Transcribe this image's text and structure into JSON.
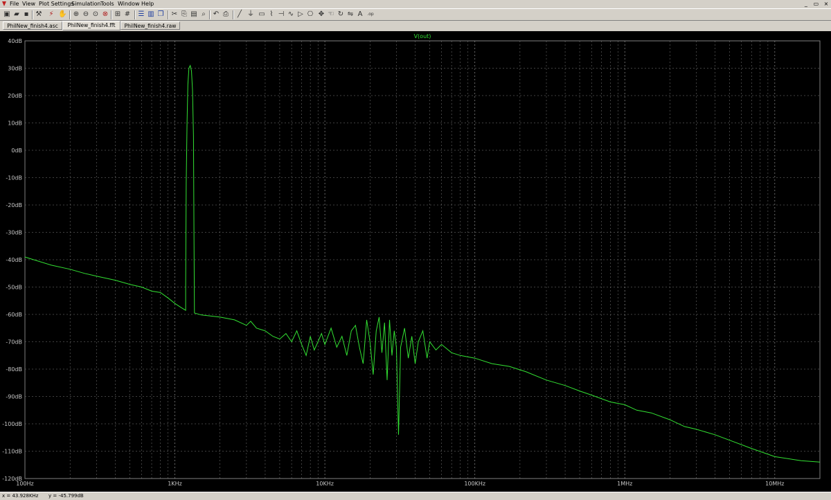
{
  "menu": {
    "items": [
      {
        "label": "File",
        "name": "menu-file"
      },
      {
        "label": "View",
        "name": "menu-view"
      },
      {
        "label": "Plot Settings",
        "name": "menu-plot-settings"
      },
      {
        "label": "Simulation",
        "name": "menu-simulation"
      },
      {
        "label": "Tools",
        "name": "menu-tools"
      },
      {
        "label": "Window",
        "name": "menu-window"
      },
      {
        "label": "Help",
        "name": "menu-help"
      }
    ]
  },
  "window_controls": {
    "minimize": "_",
    "restore": "▭",
    "close": "×"
  },
  "toolbar": {
    "icons": [
      "new-schematic-icon",
      "open-icon",
      "save-icon",
      "control-panel-icon",
      "run-icon",
      "halt-icon",
      "zoom-in-icon",
      "zoom-out-icon",
      "zoom-full-icon",
      "zoom-cancel-icon",
      "autorange-icon",
      "grid-icon",
      "tile-horizontal-icon",
      "tile-vertical-icon",
      "cascade-icon",
      "cut-icon",
      "copy-icon",
      "paste-icon",
      "find-icon",
      "undo-icon",
      "print-icon",
      "wire-icon",
      "ground-icon",
      "label-icon",
      "resistor-icon",
      "capacitor-icon",
      "inductor-icon",
      "diode-icon",
      "component-icon",
      "move-icon",
      "drag-icon",
      "rotate-icon",
      "mirror-icon",
      "text-icon",
      "spice-directive-icon"
    ]
  },
  "tabs": [
    {
      "label": "PhilNew_finish4.asc",
      "name": "tab-schematic",
      "active": false
    },
    {
      "label": "PhilNew_finish4.fft",
      "name": "tab-fft",
      "active": true
    },
    {
      "label": "PhilNew_finish4.raw",
      "name": "tab-raw",
      "active": false
    }
  ],
  "status": {
    "x": "x = 43.928KHz",
    "y": "y = -45.799dB"
  },
  "colors": {
    "trace": "#33e233",
    "grid": "#808080",
    "background": "#000000",
    "axis_text": "#c8c8c8"
  },
  "chart_data": {
    "type": "line",
    "title": "",
    "trace_label": "V(out)",
    "xscale": "log",
    "xlim": [
      100,
      20000000
    ],
    "ylim": [
      -120,
      40
    ],
    "grid": true,
    "x_ticks": [
      {
        "value": 100,
        "label": "100Hz"
      },
      {
        "value": 1000,
        "label": "1KHz"
      },
      {
        "value": 10000,
        "label": "10KHz"
      },
      {
        "value": 100000,
        "label": "100KHz"
      },
      {
        "value": 1000000,
        "label": "1MHz"
      },
      {
        "value": 10000000,
        "label": "10MHz"
      }
    ],
    "y_ticks": [
      {
        "value": 40,
        "label": "40dB"
      },
      {
        "value": 30,
        "label": "30dB"
      },
      {
        "value": 20,
        "label": "20dB"
      },
      {
        "value": 10,
        "label": "10dB"
      },
      {
        "value": 0,
        "label": "0dB"
      },
      {
        "value": -10,
        "label": "-10dB"
      },
      {
        "value": -20,
        "label": "-20dB"
      },
      {
        "value": -30,
        "label": "-30dB"
      },
      {
        "value": -40,
        "label": "-40dB"
      },
      {
        "value": -50,
        "label": "-50dB"
      },
      {
        "value": -60,
        "label": "-60dB"
      },
      {
        "value": -70,
        "label": "-70dB"
      },
      {
        "value": -80,
        "label": "-80dB"
      },
      {
        "value": -90,
        "label": "-90dB"
      },
      {
        "value": -100,
        "label": "-100dB"
      },
      {
        "value": -110,
        "label": "-110dB"
      },
      {
        "value": -120,
        "label": "-120dB"
      }
    ],
    "series": [
      {
        "points": [
          [
            100,
            -39
          ],
          [
            150,
            -42
          ],
          [
            200,
            -43.5
          ],
          [
            250,
            -45
          ],
          [
            300,
            -46
          ],
          [
            400,
            -47.5
          ],
          [
            500,
            -49
          ],
          [
            600,
            -50
          ],
          [
            700,
            -51.5
          ],
          [
            800,
            -52
          ],
          [
            900,
            -54
          ],
          [
            1000,
            -56
          ],
          [
            1100,
            -57.5
          ],
          [
            1180,
            -58.5
          ],
          [
            1180,
            -50
          ],
          [
            1190,
            -12
          ],
          [
            1205,
            10
          ],
          [
            1220,
            24
          ],
          [
            1240,
            30
          ],
          [
            1265,
            31
          ],
          [
            1290,
            29
          ],
          [
            1310,
            22
          ],
          [
            1330,
            5
          ],
          [
            1340,
            -30
          ],
          [
            1350,
            -59.5
          ],
          [
            1500,
            -60.2
          ],
          [
            2000,
            -61
          ],
          [
            2500,
            -62
          ],
          [
            3000,
            -64
          ],
          [
            3200,
            -62.5
          ],
          [
            3500,
            -65
          ],
          [
            4000,
            -66
          ],
          [
            4500,
            -68
          ],
          [
            5000,
            -69
          ],
          [
            5500,
            -67
          ],
          [
            6000,
            -70
          ],
          [
            6500,
            -66
          ],
          [
            7000,
            -71
          ],
          [
            7500,
            -75
          ],
          [
            8000,
            -68
          ],
          [
            8500,
            -73
          ],
          [
            9000,
            -70
          ],
          [
            9500,
            -67
          ],
          [
            10000,
            -71
          ],
          [
            11000,
            -65
          ],
          [
            12000,
            -72
          ],
          [
            13000,
            -68
          ],
          [
            14000,
            -75
          ],
          [
            15000,
            -66
          ],
          [
            16000,
            -64
          ],
          [
            17000,
            -72
          ],
          [
            18000,
            -78
          ],
          [
            19000,
            -62
          ],
          [
            20000,
            -70
          ],
          [
            21000,
            -82
          ],
          [
            22000,
            -66
          ],
          [
            23000,
            -61
          ],
          [
            24000,
            -74
          ],
          [
            25000,
            -63
          ],
          [
            26000,
            -84
          ],
          [
            27000,
            -62
          ],
          [
            28000,
            -75
          ],
          [
            29000,
            -66
          ],
          [
            30000,
            -72
          ],
          [
            31000,
            -104
          ],
          [
            32000,
            -72
          ],
          [
            34000,
            -65
          ],
          [
            36000,
            -76
          ],
          [
            38000,
            -68
          ],
          [
            40000,
            -78
          ],
          [
            42000,
            -70
          ],
          [
            45000,
            -66
          ],
          [
            48000,
            -76
          ],
          [
            50000,
            -70
          ],
          [
            55000,
            -73
          ],
          [
            60000,
            -71
          ],
          [
            70000,
            -74
          ],
          [
            80000,
            -75
          ],
          [
            100000,
            -76
          ],
          [
            130000,
            -78
          ],
          [
            170000,
            -79
          ],
          [
            220000,
            -81
          ],
          [
            300000,
            -84
          ],
          [
            400000,
            -86
          ],
          [
            500000,
            -88
          ],
          [
            600000,
            -89.5
          ],
          [
            800000,
            -92
          ],
          [
            1000000,
            -93
          ],
          [
            1200000,
            -95
          ],
          [
            1500000,
            -96
          ],
          [
            2000000,
            -98.5
          ],
          [
            2500000,
            -101
          ],
          [
            3000000,
            -102
          ],
          [
            4000000,
            -104
          ],
          [
            5000000,
            -106
          ],
          [
            7000000,
            -109
          ],
          [
            10000000,
            -112
          ],
          [
            15000000,
            -113.5
          ],
          [
            20000000,
            -114
          ]
        ]
      }
    ],
    "cursor": {
      "x": 43928,
      "y": -45.799
    }
  }
}
